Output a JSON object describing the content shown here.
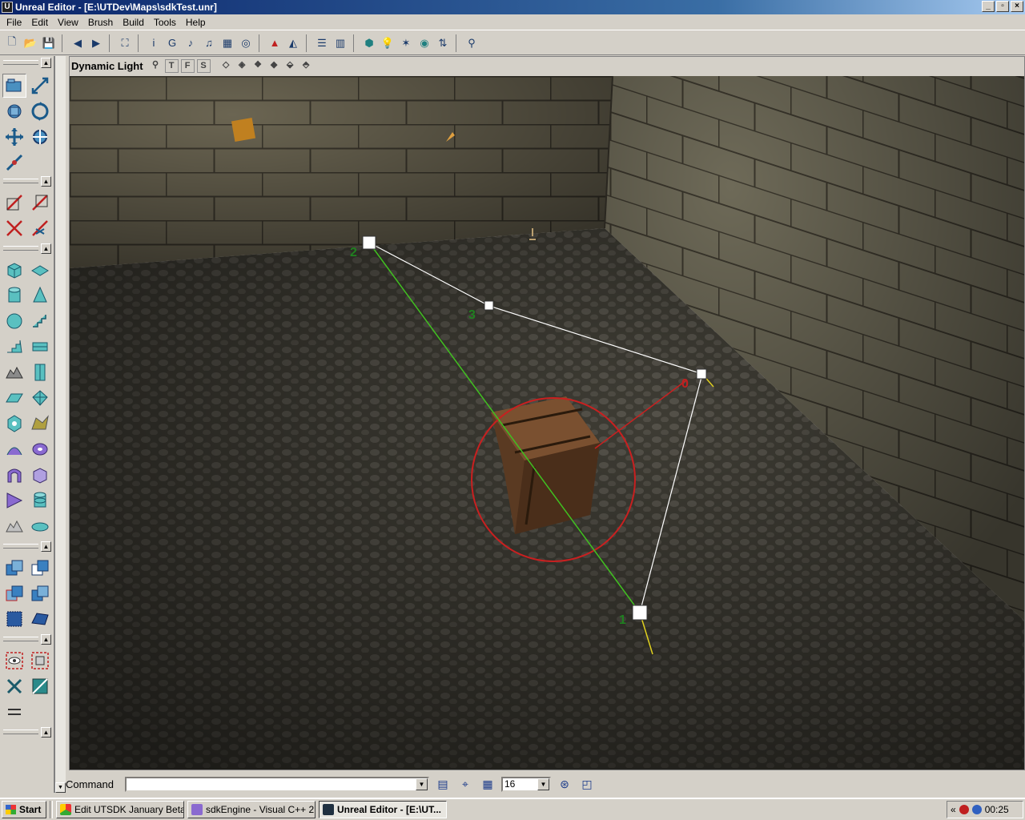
{
  "window": {
    "title": "Unreal Editor - [E:\\UTDev\\Maps\\sdkTest.unr]",
    "app_icon": "U",
    "buttons": {
      "minimize": "_",
      "maximize": "▫",
      "close": "×"
    }
  },
  "menu": [
    "File",
    "Edit",
    "View",
    "Brush",
    "Build",
    "Tools",
    "Help"
  ],
  "toolbar": {
    "icons": [
      "new-map-icon",
      "open-icon",
      "save-icon",
      "undo-icon",
      "redo-icon",
      "search-actors-icon",
      "actor-properties-icon",
      "group-browser-icon",
      "sound-browser-icon",
      "music-browser-icon",
      "texture-browser-icon",
      "mesh-browser-icon",
      "build-geometry-icon",
      "build-lighting-icon",
      "build-paths-icon",
      "build-all-icon",
      "play-map-icon",
      "bsp-icon",
      "lighting-icon",
      "paths-icon",
      "rebuild-icon",
      "options-icon",
      "actor-icon"
    ],
    "glyphs": [
      "🗋",
      "📂",
      "💾",
      "◀",
      "▶",
      "⛶",
      "i",
      "G",
      "♪",
      "♫",
      "▦",
      "◎",
      "▲",
      "◭",
      "☰",
      "▥",
      "⬢",
      "💡",
      "✶",
      "◉",
      "⇅",
      "⚲"
    ]
  },
  "viewport": {
    "title": "Dynamic Light",
    "view_buttons": [
      "T",
      "F",
      "S"
    ]
  },
  "scene": {
    "path_labels": [
      "2",
      "3",
      "0",
      "1"
    ]
  },
  "command": {
    "label": "Command",
    "input_value": "",
    "grid_value": "16"
  },
  "taskbar": {
    "start": "Start",
    "tasks": [
      {
        "label": "Edit UTSDK January Beta...",
        "color": "#e8a020"
      },
      {
        "label": "sdkEngine - Visual C++ 2...",
        "color": "#8a6ad0"
      },
      {
        "label": "Unreal Editor - [E:\\UT...",
        "color": "#203040"
      }
    ],
    "clock": "00:25",
    "tray_chevron": "«"
  }
}
